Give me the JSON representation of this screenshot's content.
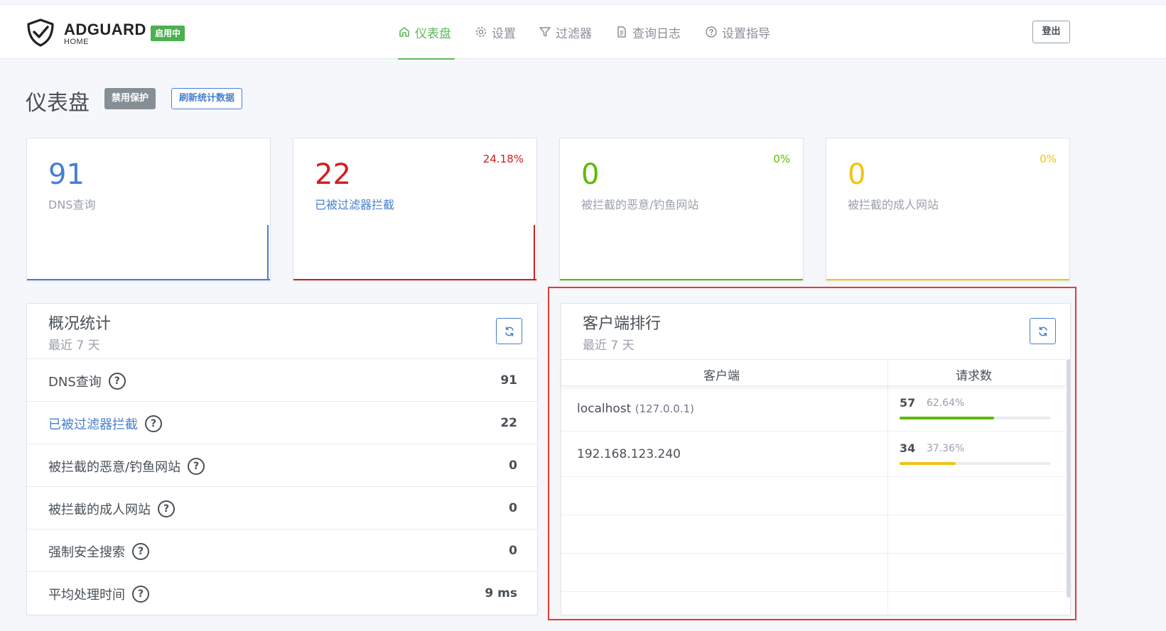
{
  "header": {
    "brand_title": "ADGUARD",
    "brand_sub": "HOME",
    "status_badge": "启用中",
    "nav": [
      {
        "label": "仪表盘",
        "icon": "home-icon",
        "active": true
      },
      {
        "label": "设置",
        "icon": "gear-icon",
        "active": false
      },
      {
        "label": "过滤器",
        "icon": "filter-icon",
        "active": false
      },
      {
        "label": "查询日志",
        "icon": "document-icon",
        "active": false
      },
      {
        "label": "设置指导",
        "icon": "question-circle-icon",
        "active": false
      }
    ],
    "logout_label": "登出"
  },
  "page": {
    "title": "仪表盘",
    "disable_label": "禁用保护",
    "refresh_label": "刷新统计数据"
  },
  "stats": [
    {
      "value": "91",
      "label": "DNS查询",
      "percent": "",
      "color": "#467fcf"
    },
    {
      "value": "22",
      "label": "已被过滤器拦截",
      "percent": "24.18%",
      "color": "#cd201f"
    },
    {
      "value": "0",
      "label": "被拦截的恶意/钓鱼网站",
      "percent": "0%",
      "color": "#5eba00"
    },
    {
      "value": "0",
      "label": "被拦截的成人网站",
      "percent": "0%",
      "color": "#f1c40f"
    }
  ],
  "overview": {
    "title": "概况统计",
    "subtitle": "最近 7 天",
    "rows": [
      {
        "label": "DNS查询",
        "value": "91",
        "link": false
      },
      {
        "label": "已被过滤器拦截",
        "value": "22",
        "link": true
      },
      {
        "label": "被拦截的恶意/钓鱼网站",
        "value": "0",
        "link": false
      },
      {
        "label": "被拦截的成人网站",
        "value": "0",
        "link": false
      },
      {
        "label": "强制安全搜索",
        "value": "0",
        "link": false
      },
      {
        "label": "平均处理时间",
        "value": "9 ms",
        "link": false
      }
    ]
  },
  "clients": {
    "title": "客户端排行",
    "subtitle": "最近 7 天",
    "col_client": "客户端",
    "col_requests": "请求数",
    "rows": [
      {
        "name": "localhost",
        "ip": "(127.0.0.1)",
        "count": "57",
        "percent": "62.64%",
        "fraction": 0.6264,
        "bar_color": "#5eba00"
      },
      {
        "name": "192.168.123.240",
        "ip": "",
        "count": "34",
        "percent": "37.36%",
        "fraction": 0.3736,
        "bar_color": "#f1c40f"
      }
    ]
  },
  "help_glyph": "?",
  "colors": {
    "accent_green": "#5cb85c",
    "primary_blue": "#467fcf",
    "highlight_red": "#e53935"
  }
}
